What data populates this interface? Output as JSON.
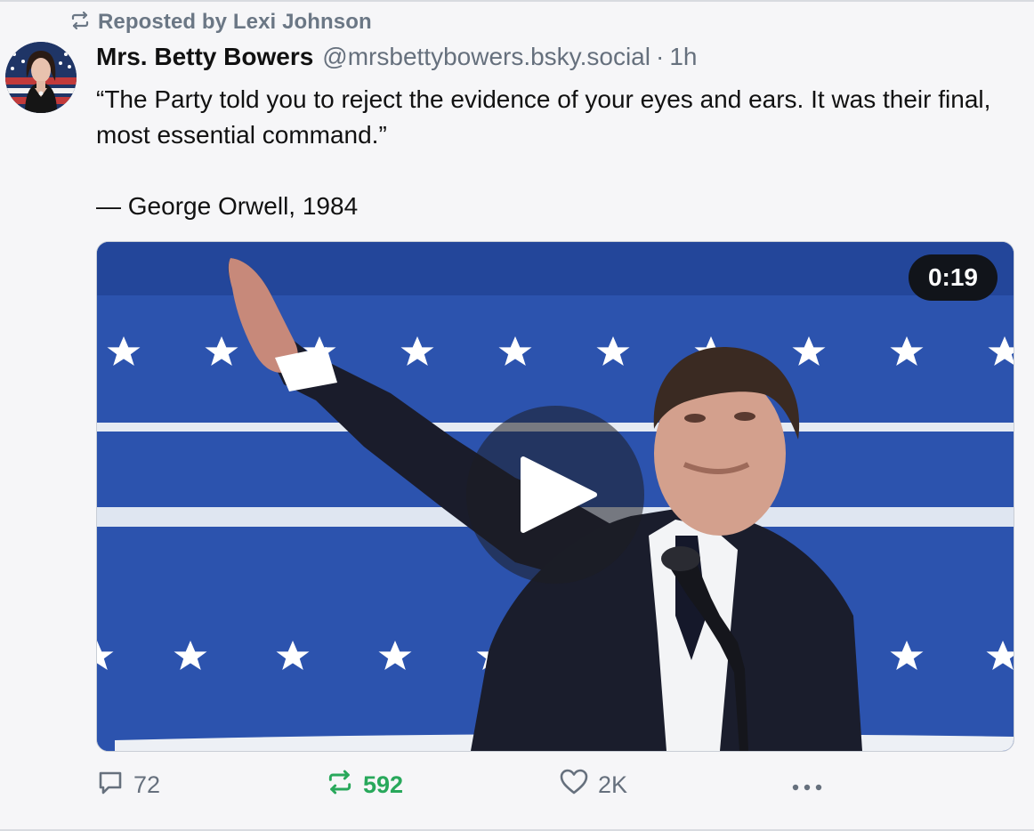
{
  "repost": {
    "label": "Reposted by Lexi Johnson"
  },
  "post": {
    "author_name": "Mrs. Betty Bowers",
    "handle": "@mrsbettybowers.bsky.social",
    "separator": "·",
    "time": "1h",
    "text_line1": "“The Party told you to reject the evidence of your eyes and ears. It was their final, most essential command.”",
    "text_line2": "— George Orwell, 1984"
  },
  "video": {
    "duration": "0:19"
  },
  "actions": {
    "replies": "72",
    "reposts": "592",
    "likes": "2K"
  },
  "colors": {
    "repost_active": "#28a85b",
    "muted": "#66707d",
    "video_background": "#2a4fa6"
  },
  "icons": [
    "repost-icon",
    "reply-icon",
    "like-icon",
    "more-icon",
    "play-icon",
    "avatar"
  ]
}
